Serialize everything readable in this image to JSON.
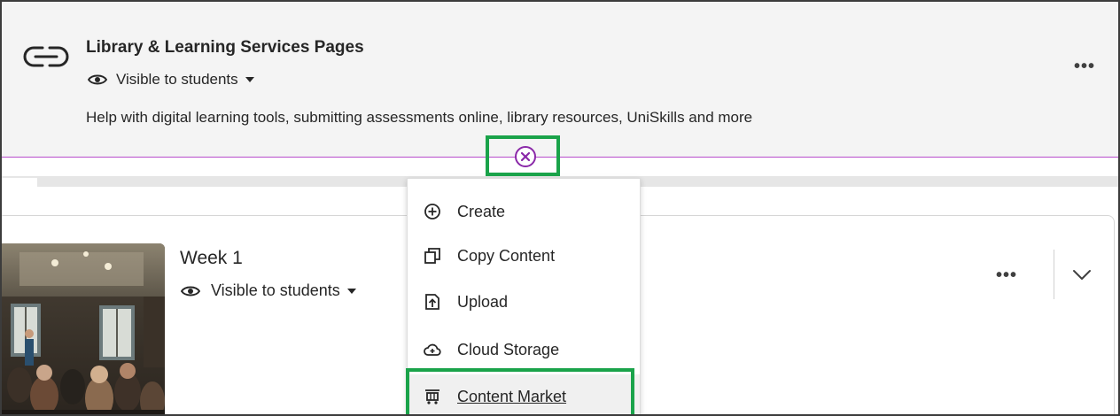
{
  "link_item": {
    "title": "Library & Learning Services Pages",
    "visibility": "Visible to students",
    "description": "Help with digital learning tools, submitting assessments online, library resources, UniSkills and more",
    "more_label": "•••"
  },
  "folder_item": {
    "title": "Week 1",
    "visibility": "Visible to students",
    "more_label": "•••"
  },
  "add_menu": {
    "items": [
      {
        "label": "Create",
        "icon": "plus-circle-icon"
      },
      {
        "label": "Copy Content",
        "icon": "copy-icon"
      },
      {
        "label": "Upload",
        "icon": "upload-icon"
      },
      {
        "label": "Cloud Storage",
        "icon": "cloud-storage-icon"
      },
      {
        "label": "Content Market",
        "icon": "market-cart-icon"
      }
    ]
  },
  "colors": {
    "divider": "#b84dcc",
    "close_button": "#8a28a8",
    "highlight": "#1aa34a"
  }
}
